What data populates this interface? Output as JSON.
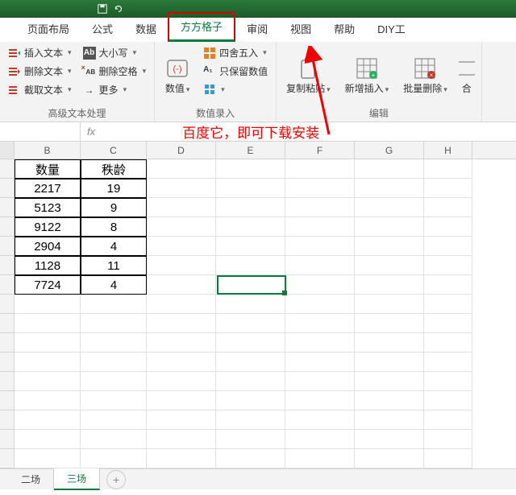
{
  "titlebar": {
    "icon1": "save",
    "icon2": "undo"
  },
  "tabs": {
    "items": [
      "页面布局",
      "公式",
      "数据",
      "方方格子",
      "审阅",
      "视图",
      "帮助",
      "DIY工"
    ],
    "active_index": 3
  },
  "ribbon": {
    "group1": {
      "label": "高级文本处理",
      "col1": {
        "insert": "插入文本",
        "delete": "删除文本",
        "extract": "截取文本"
      },
      "col2": {
        "case": "大小写",
        "delspace": "删除空格",
        "more": "更多"
      }
    },
    "group2": {
      "label": "数值录入",
      "numval": "数值",
      "round": "四舍五入",
      "keepnum": "只保留数值"
    },
    "group3": {
      "label": "编辑",
      "copypaste": "复制粘贴",
      "newins": "新增插入",
      "batchdel": "批量删除",
      "merge": "合"
    }
  },
  "annotation": {
    "text": "百度它，即可下载安装"
  },
  "formula": {
    "fx": "fx"
  },
  "columns": [
    "B",
    "C",
    "D",
    "E",
    "F",
    "G",
    "H"
  ],
  "table": {
    "headers": [
      "数量",
      "秩龄"
    ],
    "rows": [
      [
        "2217",
        "19"
      ],
      [
        "5123",
        "9"
      ],
      [
        "9122",
        "8"
      ],
      [
        "2904",
        "4"
      ],
      [
        "1128",
        "11"
      ],
      [
        "7724",
        "4"
      ]
    ]
  },
  "sheets": {
    "items": [
      "二场",
      "三场"
    ],
    "active_index": 1,
    "add": "+"
  },
  "chart_data": {
    "type": "table",
    "headers": [
      "数量",
      "秩龄"
    ],
    "rows": [
      [
        2217,
        19
      ],
      [
        5123,
        9
      ],
      [
        9122,
        8
      ],
      [
        2904,
        4
      ],
      [
        1128,
        11
      ],
      [
        7724,
        4
      ]
    ]
  }
}
